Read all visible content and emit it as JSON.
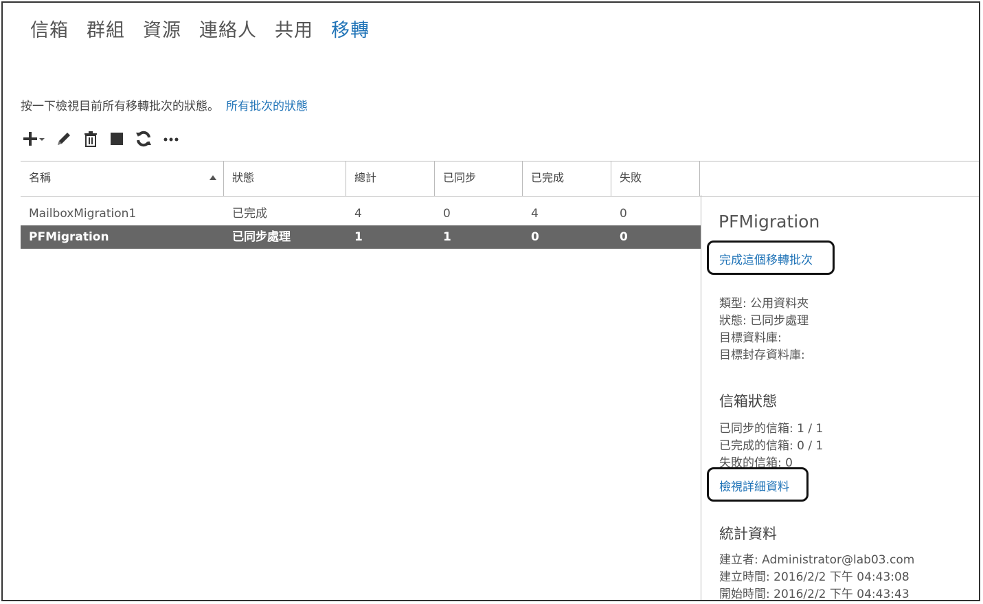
{
  "nav": {
    "items": [
      "信箱",
      "群組",
      "資源",
      "連絡人",
      "共用",
      "移轉"
    ],
    "active": "移轉"
  },
  "info": {
    "text": "按一下檢視目前所有移轉批次的狀態。",
    "link": "所有批次的狀態"
  },
  "toolbar": {
    "icons": [
      "add-icon",
      "dropdown-caret-icon",
      "edit-icon",
      "delete-icon",
      "stop-icon",
      "refresh-icon",
      "more-icon"
    ]
  },
  "table": {
    "headers": {
      "name": "名稱",
      "status": "狀態",
      "total": "總計",
      "synced": "已同步",
      "completed": "已完成",
      "failed": "失敗"
    },
    "rows": [
      {
        "name": "MailboxMigration1",
        "status": "已完成",
        "total": "4",
        "synced": "0",
        "completed": "4",
        "failed": "0",
        "selected": false
      },
      {
        "name": "PFMigration",
        "status": "已同步處理",
        "total": "1",
        "synced": "1",
        "completed": "0",
        "failed": "0",
        "selected": true
      }
    ]
  },
  "details": {
    "title": "PFMigration",
    "complete_link": "完成這個移轉批次",
    "type_line": "類型: 公用資料夾",
    "status_line": "狀態: 已同步處理",
    "target_db_line": "目標資料庫:",
    "target_archive_line": "目標封存資料庫:",
    "mailbox_status_heading": "信箱狀態",
    "synced_mailboxes": "已同步的信箱: 1 / 1",
    "completed_mailboxes": "已完成的信箱: 0 / 1",
    "failed_mailboxes": "失敗的信箱: 0",
    "view_details_link": "檢視詳細資料",
    "stats_heading": "統計資料",
    "created_by": "建立者: Administrator@lab03.com",
    "created_time": "建立時間: 2016/2/2 下午 04:43:08",
    "start_time": "開始時間: 2016/2/2 下午 04:43:43"
  },
  "colors": {
    "accent": "#1f73b7",
    "selected_row": "#666666",
    "border": "#bbbbbb"
  }
}
